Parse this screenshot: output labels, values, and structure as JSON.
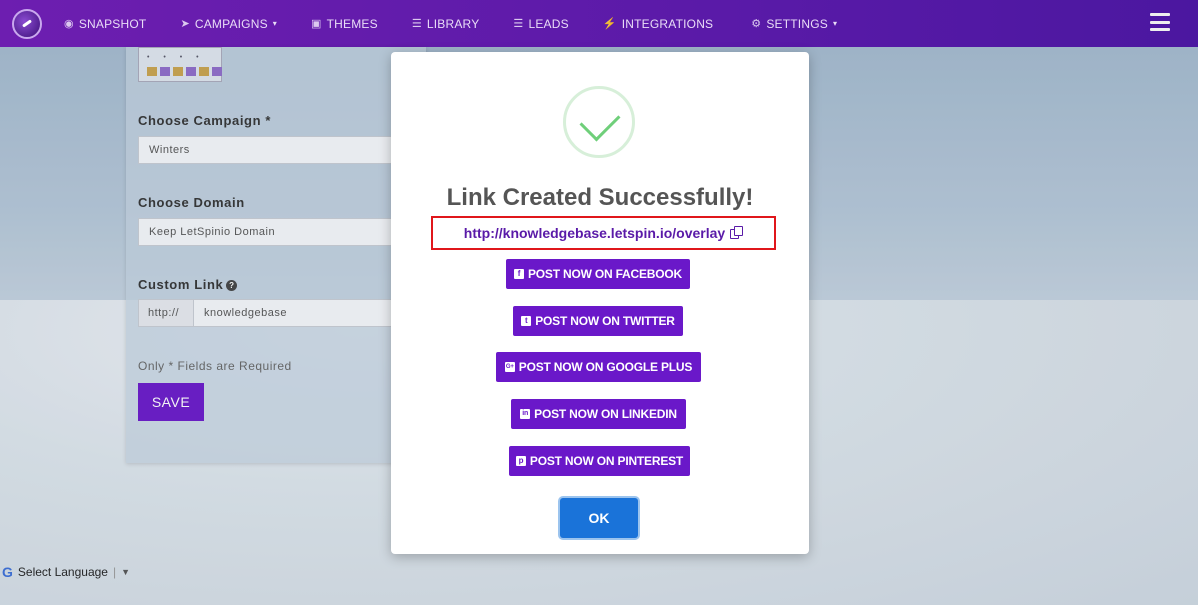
{
  "navbar": {
    "items": [
      {
        "label": "SNAPSHOT",
        "icon": "dashboard-icon"
      },
      {
        "label": "CAMPAIGNS",
        "icon": "paper-plane-icon",
        "caret": "▾"
      },
      {
        "label": "THEMES",
        "icon": "image-icon"
      },
      {
        "label": "LIBRARY",
        "icon": "list-icon"
      },
      {
        "label": "LEADS",
        "icon": "list-icon"
      },
      {
        "label": "INTEGRATIONS",
        "icon": "plug-icon"
      },
      {
        "label": "SETTINGS",
        "icon": "gears-icon",
        "caret": "▾"
      }
    ]
  },
  "form": {
    "campaign_label": "Choose Campaign *",
    "campaign_value": "Winters",
    "domain_label": "Choose Domain",
    "domain_value": "Keep LetSpinio Domain",
    "custom_link_label": "Custom Link",
    "custom_link_prefix": "http://",
    "custom_link_value": "knowledgebase",
    "required_note": "Only * Fields are Required",
    "save_label": "SAVE"
  },
  "translate": {
    "label": "Select Language",
    "arrow": "▼"
  },
  "modal": {
    "title": "Link Created Successfully!",
    "link": "http://knowledgebase.letspin.io/overlay",
    "share_buttons": [
      {
        "label": "POST NOW ON FACEBOOK",
        "glyph": "f"
      },
      {
        "label": "POST NOW ON TWITTER",
        "glyph": "t"
      },
      {
        "label": "POST NOW ON GOOGLE PLUS",
        "glyph": "G+"
      },
      {
        "label": "POST NOW ON LINKEDIN",
        "glyph": "in"
      },
      {
        "label": "POST NOW ON PINTEREST",
        "glyph": "p"
      }
    ],
    "ok_label": "OK"
  },
  "colors": {
    "navbar": "#5a1aa8",
    "primary_button": "#6a18c9",
    "ok_button": "#1a73d9",
    "link_highlight_border": "#e0161b",
    "success_check": "#6fcf7a"
  }
}
